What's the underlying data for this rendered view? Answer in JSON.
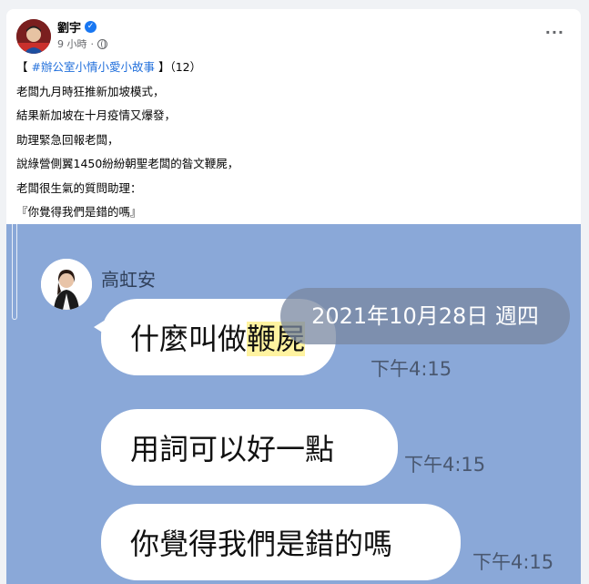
{
  "post": {
    "author": "劉宇",
    "verified_icon": "verified-badge-icon",
    "time": "9 小時",
    "separator": "·",
    "privacy_icon": "globe-icon",
    "more_icon": "more-options-icon",
    "more_label": "···",
    "lines": {
      "l1_open": "【",
      "l1_hashtag": "#辦公室小情小愛小故事",
      "l1_close": "】（12）",
      "l2": "老闆九月時狂推新加坡模式，",
      "l3": "結果新加坡在十月疫情又爆發，",
      "l4": "助理緊急回報老闆，",
      "l5": "說綠營側翼1450紛紛朝聖老闆的昝文鞭屍，",
      "l6": "老闆很生氣的質問助理：",
      "l7": "『你覺得我們是錯的嗎』"
    }
  },
  "chat": {
    "sender": "高虹安",
    "date": "2021年10月28日 週四",
    "messages": [
      {
        "before": "什麼叫做",
        "highlight": "鞭屍",
        "time": "下午4:15"
      },
      {
        "text": "用詞可以好一點",
        "time": "下午4:15"
      },
      {
        "text": "你覺得我們是錯的嗎",
        "time": "下午4:15"
      }
    ]
  },
  "colors": {
    "chat_background": "#8aa8d8",
    "hashtag": "#216fdb",
    "highlight": "#fff3a0",
    "verified": "#1877f2"
  }
}
